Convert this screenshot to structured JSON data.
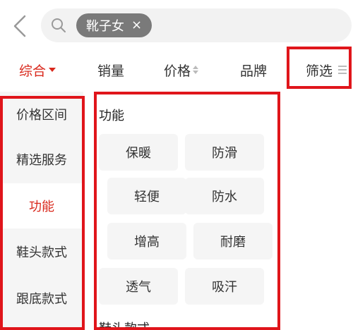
{
  "search": {
    "chip_label": "靴子女",
    "chip_close": "×"
  },
  "sort": {
    "items": [
      {
        "label": "综合"
      },
      {
        "label": "销量"
      },
      {
        "label": "价格"
      },
      {
        "label": "品牌"
      },
      {
        "label": "筛选"
      }
    ]
  },
  "sidebar": {
    "items": [
      {
        "label": "价格区间"
      },
      {
        "label": "精选服务"
      },
      {
        "label": "功能"
      },
      {
        "label": "鞋头款式"
      },
      {
        "label": "跟底款式"
      }
    ]
  },
  "panel": {
    "section_title": "功能",
    "options": [
      "保暖",
      "防滑",
      "轻便",
      "防水",
      "增高",
      "耐磨",
      "透气",
      "吸汗"
    ],
    "next_section_title": "鞋头款式"
  },
  "colors": {
    "accent": "#d9281c",
    "highlight_box": "#e0151b"
  }
}
